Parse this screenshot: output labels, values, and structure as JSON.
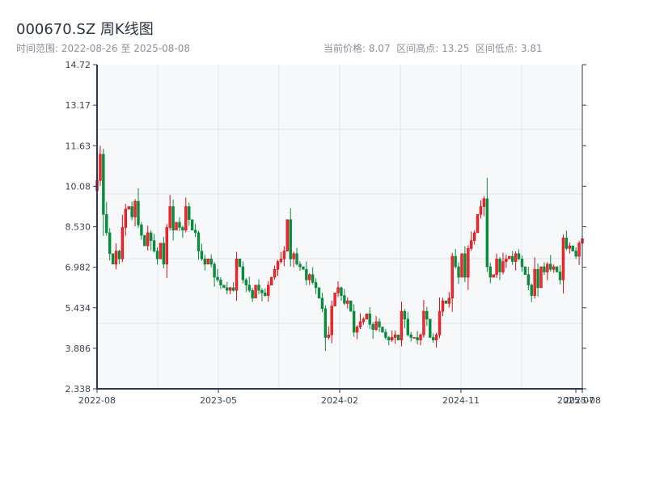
{
  "header": {
    "title": "000670.SZ 周K线图",
    "range_text": "时间范围: 2022-08-26 至 2025-08-08",
    "stats_text": "当前价格: 8.07  区间高点: 13.25  区间低点: 3.81"
  },
  "chart_data": {
    "type": "candlestick",
    "title": "000670.SZ 周K线图",
    "frequency": "weekly",
    "start_date": "2022-08-26",
    "end_date": "2025-08-08",
    "ylim": [
      2.338,
      14.72
    ],
    "y_ticks": [
      "14.72",
      "13.17",
      "11.63",
      "10.08",
      "8.530",
      "6.982",
      "5.434",
      "3.886",
      "2.338"
    ],
    "x_ticks": [
      "2022-08",
      "2023-05",
      "2024-02",
      "2024-11",
      "2025-07",
      "2025-08"
    ],
    "grid": true,
    "up_color": "#d40f14",
    "down_color": "#0a8a3c",
    "close": [
      10.3,
      11.3,
      9.0,
      8.3,
      7.5,
      7.1,
      7.6,
      7.3,
      8.5,
      9.2,
      9.3,
      8.9,
      9.5,
      8.6,
      8.2,
      7.8,
      8.3,
      8.0,
      7.6,
      7.3,
      7.9,
      7.1,
      8.5,
      9.3,
      8.4,
      8.7,
      8.5,
      8.4,
      9.3,
      8.8,
      8.4,
      8.3,
      7.6,
      7.3,
      7.1,
      7.3,
      7.1,
      6.6,
      6.5,
      6.3,
      6.2,
      6.1,
      6.2,
      6.1,
      7.3,
      7.0,
      6.5,
      6.3,
      6.1,
      5.8,
      6.3,
      6.1,
      6.0,
      5.9,
      6.3,
      6.6,
      6.9,
      7.2,
      7.3,
      7.6,
      8.8,
      7.3,
      7.5,
      7.1,
      7.0,
      6.9,
      6.5,
      6.7,
      6.4,
      6.2,
      5.8,
      5.4,
      4.3,
      4.4,
      5.5,
      6.0,
      6.2,
      5.9,
      5.6,
      5.7,
      5.3,
      4.5,
      4.7,
      4.9,
      5.0,
      5.2,
      4.8,
      4.6,
      4.9,
      4.7,
      4.5,
      4.3,
      4.2,
      4.3,
      4.4,
      4.2,
      5.3,
      5.0,
      4.4,
      4.3,
      4.3,
      4.2,
      4.4,
      5.3,
      5.0,
      4.3,
      4.2,
      4.4,
      5.3,
      5.7,
      5.6,
      5.8,
      7.4,
      7.0,
      6.6,
      7.5,
      6.6,
      7.7,
      8.0,
      8.3,
      9.0,
      9.3,
      9.6,
      7.0,
      6.6,
      6.7,
      7.3,
      6.8,
      7.2,
      7.3,
      7.4,
      7.2,
      7.5,
      7.3,
      7.0,
      6.7,
      6.3,
      5.9,
      6.9,
      6.2,
      7.0,
      6.8,
      7.1,
      6.9,
      7.0,
      6.8,
      6.5,
      8.1,
      7.7,
      7.8,
      7.6,
      7.4,
      7.9,
      8.07
    ]
  }
}
